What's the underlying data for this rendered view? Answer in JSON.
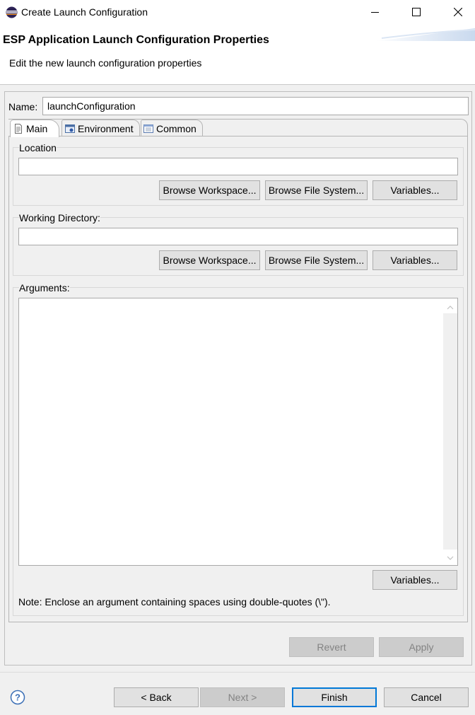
{
  "window": {
    "title": "Create Launch Configuration",
    "icon": "eclipse-icon",
    "controls": [
      "minimize-icon",
      "maximize-icon",
      "close-icon"
    ]
  },
  "header": {
    "title": "ESP Application Launch Configuration Properties",
    "description": "Edit the new launch configuration properties"
  },
  "name": {
    "label": "Name:",
    "value": "launchConfiguration"
  },
  "tabs": [
    {
      "label": "Main",
      "icon": "document-icon",
      "selected": true
    },
    {
      "label": "Environment",
      "icon": "environment-icon",
      "selected": false
    },
    {
      "label": "Common",
      "icon": "common-icon",
      "selected": false
    }
  ],
  "location": {
    "label": "Location",
    "value": "",
    "browse_workspace": "Browse Workspace...",
    "browse_file_system": "Browse File System...",
    "variables": "Variables..."
  },
  "working_directory": {
    "label": "Working Directory:",
    "value": "",
    "browse_workspace": "Browse Workspace...",
    "browse_file_system": "Browse File System...",
    "variables": "Variables..."
  },
  "arguments": {
    "label": "Arguments:",
    "value": "",
    "variables": "Variables...",
    "note": "Note: Enclose an argument containing spaces using double-quotes (\\\")."
  },
  "actions": {
    "revert": "Revert",
    "apply": "Apply"
  },
  "footer": {
    "back": "< Back",
    "next": "Next >",
    "finish": "Finish",
    "cancel": "Cancel"
  },
  "colors": {
    "default_button_border": "#0078d7",
    "dialog_background": "#f0f0f0",
    "disabled_text": "#838383"
  }
}
